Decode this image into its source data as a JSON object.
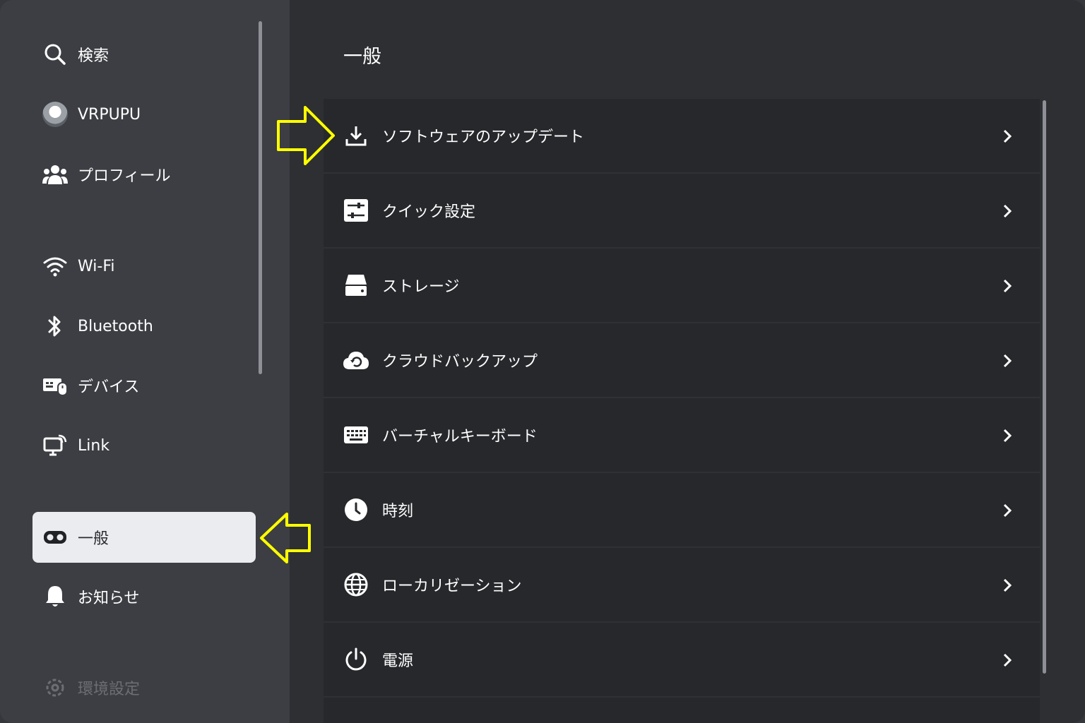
{
  "sidebar": {
    "items": [
      {
        "label": "検索",
        "icon": "search-icon"
      },
      {
        "label": "VRPUPU",
        "icon": "avatar"
      },
      {
        "label": "プロフィール",
        "icon": "people-icon"
      },
      {
        "label": "Wi-Fi",
        "icon": "wifi-icon"
      },
      {
        "label": "Bluetooth",
        "icon": "bluetooth-icon"
      },
      {
        "label": "デバイス",
        "icon": "devices-icon"
      },
      {
        "label": "Link",
        "icon": "link-monitor-icon"
      },
      {
        "label": "一般",
        "icon": "headset-icon",
        "selected": true
      },
      {
        "label": "お知らせ",
        "icon": "bell-icon"
      },
      {
        "label": "環境設定",
        "icon": "gear-icon"
      }
    ]
  },
  "main": {
    "title": "一般",
    "rows": [
      {
        "label": "ソフトウェアのアップデート",
        "icon": "download-icon"
      },
      {
        "label": "クイック設定",
        "icon": "sliders-icon"
      },
      {
        "label": "ストレージ",
        "icon": "storage-icon"
      },
      {
        "label": "クラウドバックアップ",
        "icon": "cloud-backup-icon"
      },
      {
        "label": "バーチャルキーボード",
        "icon": "keyboard-icon"
      },
      {
        "label": "時刻",
        "icon": "clock-icon"
      },
      {
        "label": "ローカリゼーション",
        "icon": "globe-icon"
      },
      {
        "label": "電源",
        "icon": "power-icon"
      }
    ]
  },
  "colors": {
    "highlight_arrow": "#ffff00",
    "selected_bg": "#ebecf0",
    "sidebar_bg": "#3c3e43",
    "list_bg": "#26282b"
  }
}
